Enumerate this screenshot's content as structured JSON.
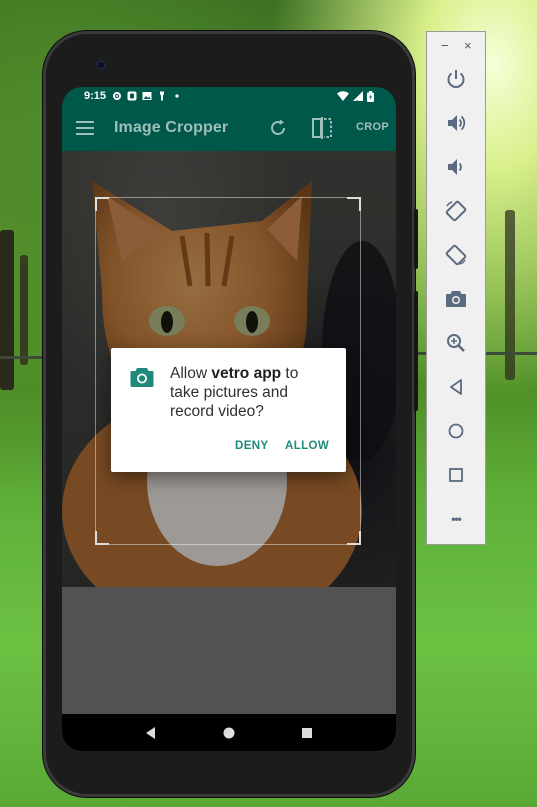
{
  "status_bar": {
    "time": "9:15",
    "left_icons": [
      "gear-icon",
      "media-icon",
      "image-icon",
      "flashlight-icon",
      "dot-icon"
    ],
    "right_icons": [
      "wifi-icon",
      "signal-icon",
      "battery-icon"
    ]
  },
  "toolbar": {
    "title": "Image Cropper",
    "crop_label": "CROP"
  },
  "dialog": {
    "message_prefix": "Allow ",
    "app_name": "vetro app",
    "message_suffix": " to take pictures and record video?",
    "deny_label": "DENY",
    "allow_label": "ALLOW"
  },
  "emulator_panel": {
    "minimize_label": "−",
    "close_label": "×",
    "more_label": "•••"
  },
  "colors": {
    "toolbar": "#00584b",
    "dialog_accent": "#1f8a7c",
    "panel_bg": "#f0f0f0"
  }
}
